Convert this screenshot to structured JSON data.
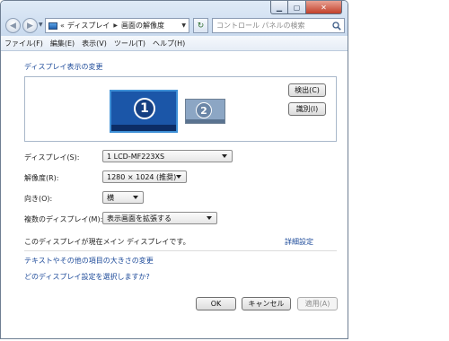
{
  "window": {
    "caption_buttons": {
      "minimize_icon": "minimize-icon",
      "maximize_icon": "maximize-icon",
      "close_icon": "close-icon"
    }
  },
  "nav": {
    "back_icon": "back-arrow-icon",
    "forward_icon": "forward-arrow-icon"
  },
  "address": {
    "overflow": "«",
    "crumb1": "ディスプレイ",
    "crumb2": "画面の解像度"
  },
  "search": {
    "placeholder": "コントロール パネルの検索"
  },
  "menu": [
    "ファイル(F)",
    "編集(E)",
    "表示(V)",
    "ツール(T)",
    "ヘルプ(H)"
  ],
  "heading": "ディスプレイ表示の変更",
  "monitors": {
    "primary": "1",
    "secondary": "2"
  },
  "buttons": {
    "detect": "検出(C)",
    "identify": "識別(I)",
    "ok": "OK",
    "cancel": "キャンセル",
    "apply": "適用(A)"
  },
  "settings": {
    "display_label": "ディスプレイ(S):",
    "display_value": "1 LCD-MF223XS",
    "resolution_label": "解像度(R):",
    "resolution_value": "1280 × 1024 (推奨)",
    "orientation_label": "向き(O):",
    "orientation_value": "横",
    "multiple_label": "複数のディスプレイ(M):",
    "multiple_value": "表示画面を拡張する"
  },
  "status_text": "このディスプレイが現在メイン ディスプレイです。",
  "advanced_link": "詳細設定",
  "links": {
    "text_size": "テキストやその他の項目の大きさの変更",
    "which_settings": "どのディスプレイ設定を選択しますか?"
  },
  "colors": {
    "link": "#1e4b9a",
    "primary_monitor": "#1b56a8",
    "secondary_monitor": "#8ca6c4"
  }
}
